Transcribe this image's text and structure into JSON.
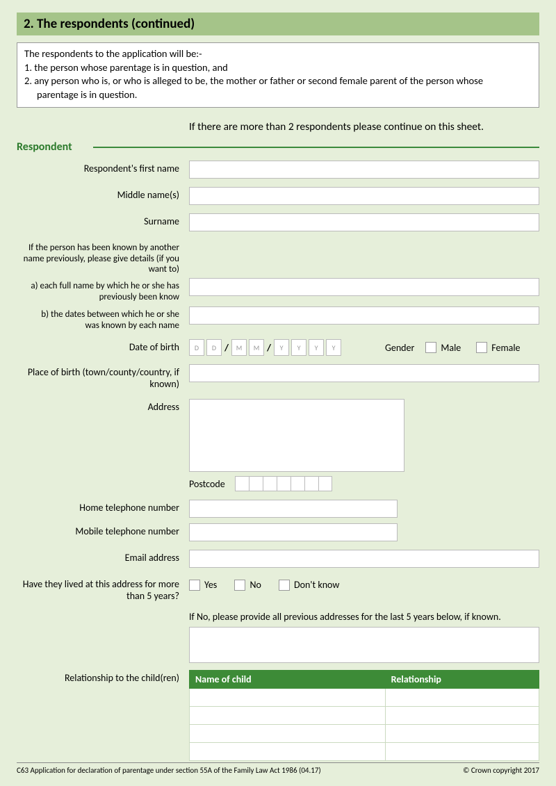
{
  "header": {
    "title": "2. The respondents (continued)"
  },
  "intro": {
    "lead": "The respondents to the application will be:-",
    "line1": "1. the person whose parentage is in question, and",
    "line2a": "2. any person who is, or who is alleged to be, the mother or father or second female parent of the person whose",
    "line2b": "parentage is in question."
  },
  "continue_note": "If there are more than 2 respondents please continue on this sheet.",
  "subhead": "Respondent",
  "labels": {
    "first_name": "Respondent's first name",
    "middle": "Middle name(s)",
    "surname": "Surname",
    "alias_intro": "If the person has been known by another name previously, please give details (if you want to)",
    "alias_a": "a) each full name by which he or she has previously been know",
    "alias_b": "b) the dates between which he or she was known by each name",
    "dob": "Date of birth",
    "gender": "Gender",
    "male": "Male",
    "female": "Female",
    "pob": "Place of birth (town/county/country, if known)",
    "address": "Address",
    "postcode": "Postcode",
    "home_tel": "Home telephone number",
    "mobile_tel": "Mobile telephone number",
    "email": "Email address",
    "lived5": "Have they lived at this address for more than 5 years?",
    "yes": "Yes",
    "no": "No",
    "dontknow": "Don't know",
    "ifno": "If No, please provide all previous addresses for the last 5 years below, if known.",
    "relchild": "Relationship to the child(ren)"
  },
  "dob_ph": {
    "d": "D",
    "m": "M",
    "y": "Y"
  },
  "table": {
    "col1": "Name of child",
    "col2": "Relationship"
  },
  "footer": {
    "left": "C63 Application for declaration of parentage under section 55A of the Family Law Act 1986 (04.17)",
    "right": "© Crown copyright 2017"
  }
}
